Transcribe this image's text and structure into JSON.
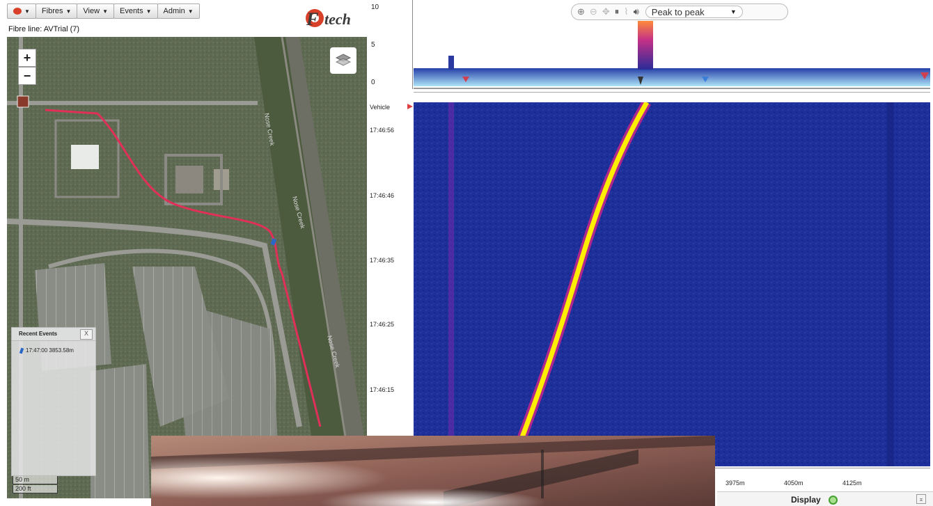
{
  "toolbar": {
    "menus": [
      {
        "label": "Fibres"
      },
      {
        "label": "View"
      },
      {
        "label": "Events"
      },
      {
        "label": "Admin"
      }
    ]
  },
  "logo": {
    "text": "Fotech"
  },
  "fibre_line": "Fibre line: AVTrial (7)",
  "map": {
    "zoom_in": "+",
    "zoom_out": "−",
    "recent_events": {
      "title": "Recent Events",
      "close": "X",
      "items": [
        {
          "text": "17:47:00 3853.58m"
        }
      ]
    },
    "scale": {
      "metric": "50 m",
      "imperial": "200 ft"
    }
  },
  "amplitude_chart": {
    "y_ticks": [
      "10",
      "5",
      "0"
    ],
    "mode_select": "Peak to peak"
  },
  "waterfall": {
    "vehicle_label": "Vehicle",
    "time_ticks": [
      "17:46:56",
      "17:46:46",
      "17:46:35",
      "17:46:25",
      "17:46:15"
    ],
    "x_ticks": [
      "3975m",
      "4050m",
      "4125m"
    ]
  },
  "display": {
    "label": "Display"
  },
  "colors": {
    "waterfall_bg": "#1c2e96",
    "track": "#ffee00",
    "track_edge": "#e0268a",
    "map_route": "#e0305a"
  }
}
